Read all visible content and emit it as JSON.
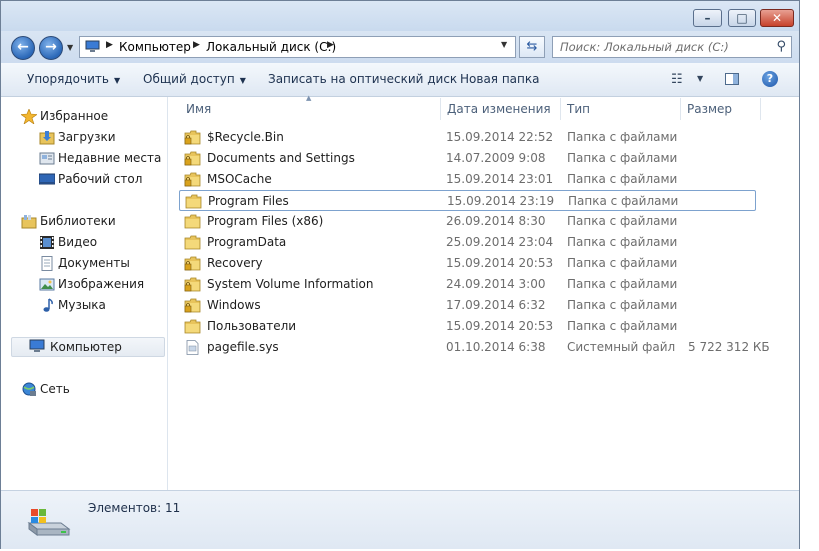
{
  "window": {
    "controls": {
      "minimize": "–",
      "maximize": "□",
      "close": "✕"
    }
  },
  "nav": {
    "back": "←",
    "forward": "→"
  },
  "address": {
    "crumbs": [
      "Компьютер",
      "Локальный диск (C:)"
    ],
    "icon": "computer-icon"
  },
  "search": {
    "placeholder": "Поиск: Локальный диск (C:)"
  },
  "toolbar": {
    "organize": "Упорядочить",
    "share": "Общий доступ",
    "burn": "Записать на оптический диск",
    "new_folder": "Новая папка"
  },
  "sidebar": {
    "favorites": {
      "label": "Избранное",
      "icon": "star-icon"
    },
    "favorites_items": [
      {
        "label": "Загрузки",
        "icon": "downloads-icon"
      },
      {
        "label": "Недавние места",
        "icon": "recent-places-icon"
      },
      {
        "label": "Рабочий стол",
        "icon": "desktop-icon"
      }
    ],
    "libraries": {
      "label": "Библиотеки",
      "icon": "library-icon"
    },
    "libraries_items": [
      {
        "label": "Видео",
        "icon": "video-icon"
      },
      {
        "label": "Документы",
        "icon": "documents-icon"
      },
      {
        "label": "Изображения",
        "icon": "pictures-icon"
      },
      {
        "label": "Музыка",
        "icon": "music-icon"
      }
    ],
    "computer": {
      "label": "Компьютер",
      "icon": "computer-icon"
    },
    "network": {
      "label": "Сеть",
      "icon": "network-icon"
    }
  },
  "columns": {
    "name": "Имя",
    "date": "Дата изменения",
    "type": "Тип",
    "size": "Размер"
  },
  "files": [
    {
      "name": "$Recycle.Bin",
      "date": "15.09.2014 22:52",
      "type": "Папка с файлами",
      "size": "",
      "locked": true,
      "kind": "folder"
    },
    {
      "name": "Documents and Settings",
      "date": "14.07.2009 9:08",
      "type": "Папка с файлами",
      "size": "",
      "locked": true,
      "kind": "folder"
    },
    {
      "name": "MSOCache",
      "date": "15.09.2014 23:01",
      "type": "Папка с файлами",
      "size": "",
      "locked": true,
      "kind": "folder"
    },
    {
      "name": "Program Files",
      "date": "15.09.2014 23:19",
      "type": "Папка с файлами",
      "size": "",
      "locked": false,
      "kind": "folder",
      "selected": true
    },
    {
      "name": "Program Files (x86)",
      "date": "26.09.2014 8:30",
      "type": "Папка с файлами",
      "size": "",
      "locked": false,
      "kind": "folder"
    },
    {
      "name": "ProgramData",
      "date": "25.09.2014 23:04",
      "type": "Папка с файлами",
      "size": "",
      "locked": false,
      "kind": "folder"
    },
    {
      "name": "Recovery",
      "date": "15.09.2014 20:53",
      "type": "Папка с файлами",
      "size": "",
      "locked": true,
      "kind": "folder"
    },
    {
      "name": "System Volume Information",
      "date": "24.09.2014 3:00",
      "type": "Папка с файлами",
      "size": "",
      "locked": true,
      "kind": "folder"
    },
    {
      "name": "Windows",
      "date": "17.09.2014 6:32",
      "type": "Папка с файлами",
      "size": "",
      "locked": true,
      "kind": "folder"
    },
    {
      "name": "Пользователи",
      "date": "15.09.2014 20:53",
      "type": "Папка с файлами",
      "size": "",
      "locked": false,
      "kind": "folder"
    },
    {
      "name": "pagefile.sys",
      "date": "01.10.2014 6:38",
      "type": "Системный файл",
      "size": "5 722 312 КБ",
      "locked": false,
      "kind": "file"
    }
  ],
  "details": {
    "count_text": "Элементов: 11",
    "icon": "drive-icon"
  },
  "colors": {
    "folder": "#e8c45c",
    "accent": "#2b68b8",
    "selection_border": "#7da2ce"
  }
}
